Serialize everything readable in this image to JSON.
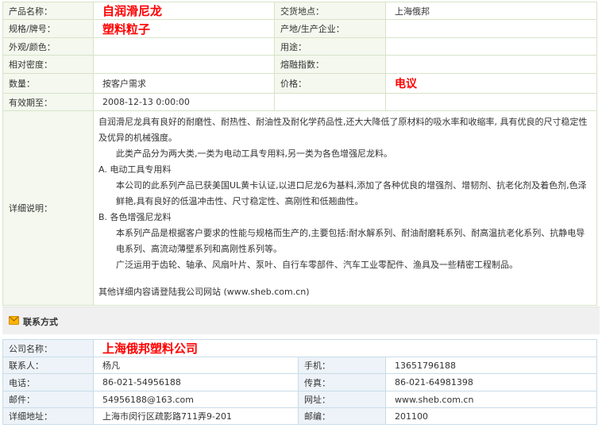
{
  "product": {
    "name_label": "产品名称：",
    "name_value": "自润滑尼龙",
    "delivery_label": "交货地点：",
    "delivery_value": "上海俄邦",
    "spec_label": "规格/牌号：",
    "spec_value": "塑料粒子",
    "origin_label": "产地/生产企业：",
    "origin_value": "",
    "appearance_label": "外观/颜色：",
    "appearance_value": "",
    "usage_label": "用途：",
    "usage_value": "",
    "density_label": "相对密度：",
    "density_value": "",
    "mfi_label": "熔融指数：",
    "mfi_value": "",
    "quantity_label": "数量：",
    "quantity_value": "按客户需求",
    "price_label": "价格：",
    "price_value": "电议",
    "validity_label": "有效期至：",
    "validity_value": "2008-12-13 0:00:00",
    "detail_label": "详细说明："
  },
  "detail": {
    "p1": "自润滑尼龙具有良好的耐磨性、耐热性、耐油性及耐化学药品性,还大大降低了原材料的吸水率和收缩率, 具有优良的尺寸稳定性及优异的机械强度。",
    "p2": "此类产品分为两大类,一类为电动工具专用料,另一类为各色增强尼龙料。",
    "h_a": "A. 电动工具专用料",
    "p3": "本公司的此系列产品已获美国UL黄卡认证,以进口尼龙6为基料,添加了各种优良的增强剂、增韧剂、抗老化剂及着色剂,色泽鲜艳,具有良好的低温冲击性、尺寸稳定性、高刚性和低翘曲性。",
    "h_b": "B. 各色增强尼龙料",
    "p4": "本系列产品是根据客户要求的性能与规格而生产的,主要包括:耐水解系列、耐油耐磨耗系列、耐高温抗老化系列、抗静电导电系列、高流动薄壁系列和高刚性系列等。",
    "p5": "广泛运用于齿轮、轴承、风扇叶片、泵叶、自行车零部件、汽车工业零配件、渔具及一些精密工程制品。",
    "p6": "其他详细内容请登陆我公司网站 (www.sheb.com.cn)"
  },
  "contact_header": {
    "title": "联系方式",
    "icon": "envelope-icon"
  },
  "contact": {
    "company_label": "公司名称：",
    "company_value": "上海俄邦塑料公司",
    "person_label": "联系人：",
    "person_value": "杨凡",
    "mobile_label": "手机：",
    "mobile_value": "13651796188",
    "phone_label": "电话：",
    "phone_value": "86-021-54956188",
    "fax_label": "传真：",
    "fax_value": "86-021-64981398",
    "email_label": "邮件：",
    "email_value": "54956188@163.com",
    "website_label": "网址：",
    "website_value": "www.sheb.com.cn",
    "address_label": "详细地址：",
    "address_value": "上海市闵行区疏影路711弄9-201",
    "zip_label": "邮编：",
    "zip_value": "201100"
  },
  "colors": {
    "highlight": "#ff0000",
    "label_bg_product": "#f4f8ee",
    "label_bg_contact": "#edf3f8",
    "icon": "#ffb300"
  }
}
